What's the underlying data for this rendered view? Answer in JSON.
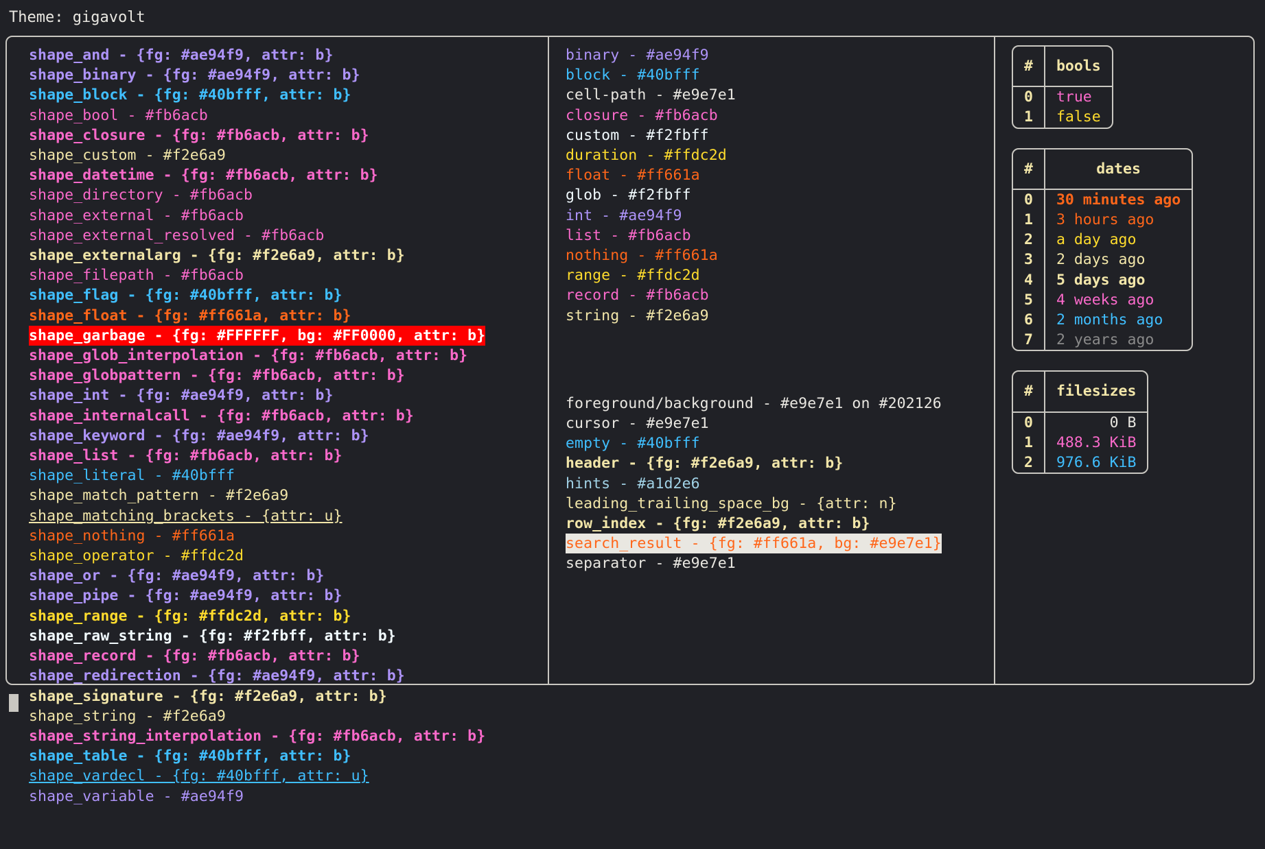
{
  "header": {
    "theme_label": "Theme: gigavolt"
  },
  "left_column": {
    "name": "shape-entries",
    "entries": [
      {
        "text": "shape_and - {fg: #ae94f9, attr: b}",
        "style": "c-purple b"
      },
      {
        "text": "shape_binary - {fg: #ae94f9, attr: b}",
        "style": "c-purple b"
      },
      {
        "text": "shape_block - {fg: #40bfff, attr: b}",
        "style": "c-cyan b"
      },
      {
        "text": "shape_bool - #fb6acb",
        "style": "c-pink"
      },
      {
        "text": "shape_closure - {fg: #fb6acb, attr: b}",
        "style": "c-pink b"
      },
      {
        "text": "shape_custom - #f2e6a9",
        "style": "c-cream"
      },
      {
        "text": "shape_datetime - {fg: #fb6acb, attr: b}",
        "style": "c-pink b"
      },
      {
        "text": "shape_directory - #fb6acb",
        "style": "c-pink"
      },
      {
        "text": "shape_external - #fb6acb",
        "style": "c-pink"
      },
      {
        "text": "shape_external_resolved - #fb6acb",
        "style": "c-pink"
      },
      {
        "text": "shape_externalarg - {fg: #f2e6a9, attr: b}",
        "style": "c-cream b"
      },
      {
        "text": "shape_filepath - #fb6acb",
        "style": "c-pink"
      },
      {
        "text": "shape_flag - {fg: #40bfff, attr: b}",
        "style": "c-cyan b"
      },
      {
        "text": "shape_float - {fg: #ff661a, attr: b}",
        "style": "c-orange b"
      },
      {
        "text": "shape_garbage - {fg: #FFFFFF, bg: #FF0000, attr: b}",
        "style": "hl-garbage b"
      },
      {
        "text": "shape_glob_interpolation - {fg: #fb6acb, attr: b}",
        "style": "c-pink b"
      },
      {
        "text": "shape_globpattern - {fg: #fb6acb, attr: b}",
        "style": "c-pink b"
      },
      {
        "text": "shape_int - {fg: #ae94f9, attr: b}",
        "style": "c-purple b"
      },
      {
        "text": "shape_internalcall - {fg: #fb6acb, attr: b}",
        "style": "c-pink b"
      },
      {
        "text": "shape_keyword - {fg: #ae94f9, attr: b}",
        "style": "c-purple b"
      },
      {
        "text": "shape_list - {fg: #fb6acb, attr: b}",
        "style": "c-pink b"
      },
      {
        "text": "shape_literal - #40bfff",
        "style": "c-cyan"
      },
      {
        "text": "shape_match_pattern - #f2e6a9",
        "style": "c-cream"
      },
      {
        "text": "shape_matching_brackets - {attr: u}",
        "style": "c-cream u"
      },
      {
        "text": "shape_nothing - #ff661a",
        "style": "c-orange"
      },
      {
        "text": "shape_operator - #ffdc2d",
        "style": "c-yellow"
      },
      {
        "text": "shape_or - {fg: #ae94f9, attr: b}",
        "style": "c-purple b"
      },
      {
        "text": "shape_pipe - {fg: #ae94f9, attr: b}",
        "style": "c-purple b"
      },
      {
        "text": "shape_range - {fg: #ffdc2d, attr: b}",
        "style": "c-yellow b"
      },
      {
        "text": "shape_raw_string - {fg: #f2fbff, attr: b}",
        "style": "c-white b"
      },
      {
        "text": "shape_record - {fg: #fb6acb, attr: b}",
        "style": "c-pink b"
      },
      {
        "text": "shape_redirection - {fg: #ae94f9, attr: b}",
        "style": "c-purple b"
      },
      {
        "text": "shape_signature - {fg: #f2e6a9, attr: b}",
        "style": "c-cream b"
      },
      {
        "text": "shape_string - #f2e6a9",
        "style": "c-cream"
      },
      {
        "text": "shape_string_interpolation - {fg: #fb6acb, attr: b}",
        "style": "c-pink b"
      },
      {
        "text": "shape_table - {fg: #40bfff, attr: b}",
        "style": "c-cyan b"
      },
      {
        "text": "shape_vardecl - {fg: #40bfff, attr: u}",
        "style": "c-cyan u"
      },
      {
        "text": "shape_variable - #ae94f9",
        "style": "c-purple"
      }
    ]
  },
  "mid_column": {
    "name": "type-and-ui-entries",
    "types": [
      {
        "text": "binary - #ae94f9",
        "style": "c-purple"
      },
      {
        "text": "block - #40bfff",
        "style": "c-cyan"
      },
      {
        "text": "cell-path - #e9e7e1",
        "style": "c-default"
      },
      {
        "text": "closure - #fb6acb",
        "style": "c-pink"
      },
      {
        "text": "custom - #f2fbff",
        "style": "c-white"
      },
      {
        "text": "duration - #ffdc2d",
        "style": "c-yellow"
      },
      {
        "text": "float - #ff661a",
        "style": "c-orange"
      },
      {
        "text": "glob - #f2fbff",
        "style": "c-white"
      },
      {
        "text": "int - #ae94f9",
        "style": "c-purple"
      },
      {
        "text": "list - #fb6acb",
        "style": "c-pink"
      },
      {
        "text": "nothing - #ff661a",
        "style": "c-orange"
      },
      {
        "text": "range - #ffdc2d",
        "style": "c-yellow"
      },
      {
        "text": "record - #fb6acb",
        "style": "c-pink"
      },
      {
        "text": "string - #f2e6a9",
        "style": "c-cream"
      }
    ],
    "ui": [
      {
        "text": "foreground/background - #e9e7e1 on #202126",
        "style": "c-default"
      },
      {
        "text": "cursor - #e9e7e1",
        "style": "c-default"
      },
      {
        "text": "empty - #40bfff",
        "style": "c-cyan"
      },
      {
        "text": "header - {fg: #f2e6a9, attr: b}",
        "style": "c-cream b"
      },
      {
        "text": "hints - #a1d2e6",
        "style": "c-hints"
      },
      {
        "text": "leading_trailing_space_bg - {attr: n}",
        "style": "c-cream"
      },
      {
        "text": "row_index - {fg: #f2e6a9, attr: b}",
        "style": "c-cream b"
      },
      {
        "text": "search_result - {fg: #ff661a, bg: #e9e7e1}",
        "style": "hl-search"
      },
      {
        "text": "separator - #e9e7e1",
        "style": "c-default"
      }
    ]
  },
  "right_column": {
    "name": "sample-tables",
    "tables": [
      {
        "name": "bools-table",
        "index_header": "#",
        "value_header": "bools",
        "align": "left",
        "rows": [
          {
            "index": "0",
            "value": "true",
            "style": "c-pink"
          },
          {
            "index": "1",
            "value": "false",
            "style": "c-yellow"
          }
        ]
      },
      {
        "name": "dates-table",
        "index_header": "#",
        "value_header": "dates",
        "align": "left",
        "rows": [
          {
            "index": "0",
            "value": "30 minutes ago",
            "style": "c-orange b"
          },
          {
            "index": "1",
            "value": "3 hours ago",
            "style": "c-orange"
          },
          {
            "index": "2",
            "value": "a day ago",
            "style": "c-yellow"
          },
          {
            "index": "3",
            "value": "2 days ago",
            "style": "c-cream"
          },
          {
            "index": "4",
            "value": "5 days ago",
            "style": "c-cream b"
          },
          {
            "index": "5",
            "value": "4 weeks ago",
            "style": "c-pink"
          },
          {
            "index": "6",
            "value": "2 months ago",
            "style": "c-cyan"
          },
          {
            "index": "7",
            "value": "2 years ago",
            "style": "c-gray"
          }
        ]
      },
      {
        "name": "filesizes-table",
        "index_header": "#",
        "value_header": "filesizes",
        "align": "right",
        "rows": [
          {
            "index": "0",
            "value": "0 B",
            "style": "c-default"
          },
          {
            "index": "1",
            "value": "488.3 KiB",
            "style": "c-pink"
          },
          {
            "index": "2",
            "value": "976.6 KiB",
            "style": "c-cyan"
          }
        ]
      }
    ]
  },
  "prompt": {
    "cursor": "█"
  },
  "colors": {
    "background": "#202126",
    "foreground": "#e9e7e1",
    "purple": "#ae94f9",
    "cyan": "#40bfff",
    "pink": "#fb6acb",
    "cream": "#f2e6a9",
    "orange": "#ff661a",
    "yellow": "#ffdc2d",
    "white": "#f2fbff",
    "hints": "#a1d2e6",
    "garbage_fg": "#FFFFFF",
    "garbage_bg": "#FF0000",
    "search_fg": "#ff661a",
    "search_bg": "#e9e7e1",
    "border": "#c9c7c1"
  }
}
